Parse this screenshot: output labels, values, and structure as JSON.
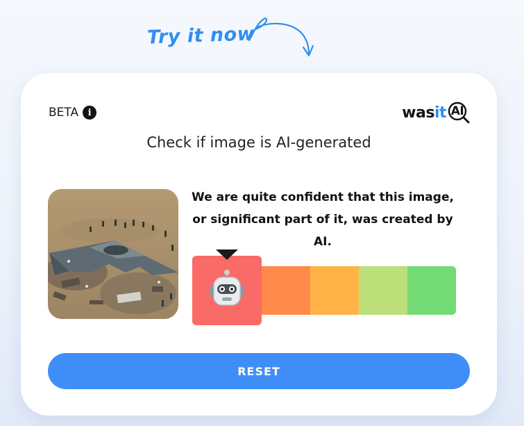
{
  "promo": {
    "try_label": "Try it now",
    "arrow_icon": "curved-arrow-icon"
  },
  "card": {
    "beta_label": "BETA",
    "info_icon": "info-icon",
    "logo": {
      "was": "was",
      "it": "it",
      "ai": "AI",
      "icon": "magnifier-icon"
    },
    "heading": "Check if image is AI-generated",
    "image_alt": "stealth bomber aircraft wreck in desert",
    "verdict": "We are quite confident that this image, or significant part of it, was created by AI.",
    "scale": {
      "levels": 5,
      "selected_index": 0,
      "colors": [
        "#fa6a66",
        "#ff8a4a",
        "#ffb347",
        "#bddf7a",
        "#74da74"
      ],
      "selected_icon": "robot-icon",
      "pointer_icon": "caret-down-icon"
    },
    "reset_label": "RESET"
  },
  "colors": {
    "accent": "#3f8ef8",
    "brand_blue": "#2f8ff0"
  }
}
